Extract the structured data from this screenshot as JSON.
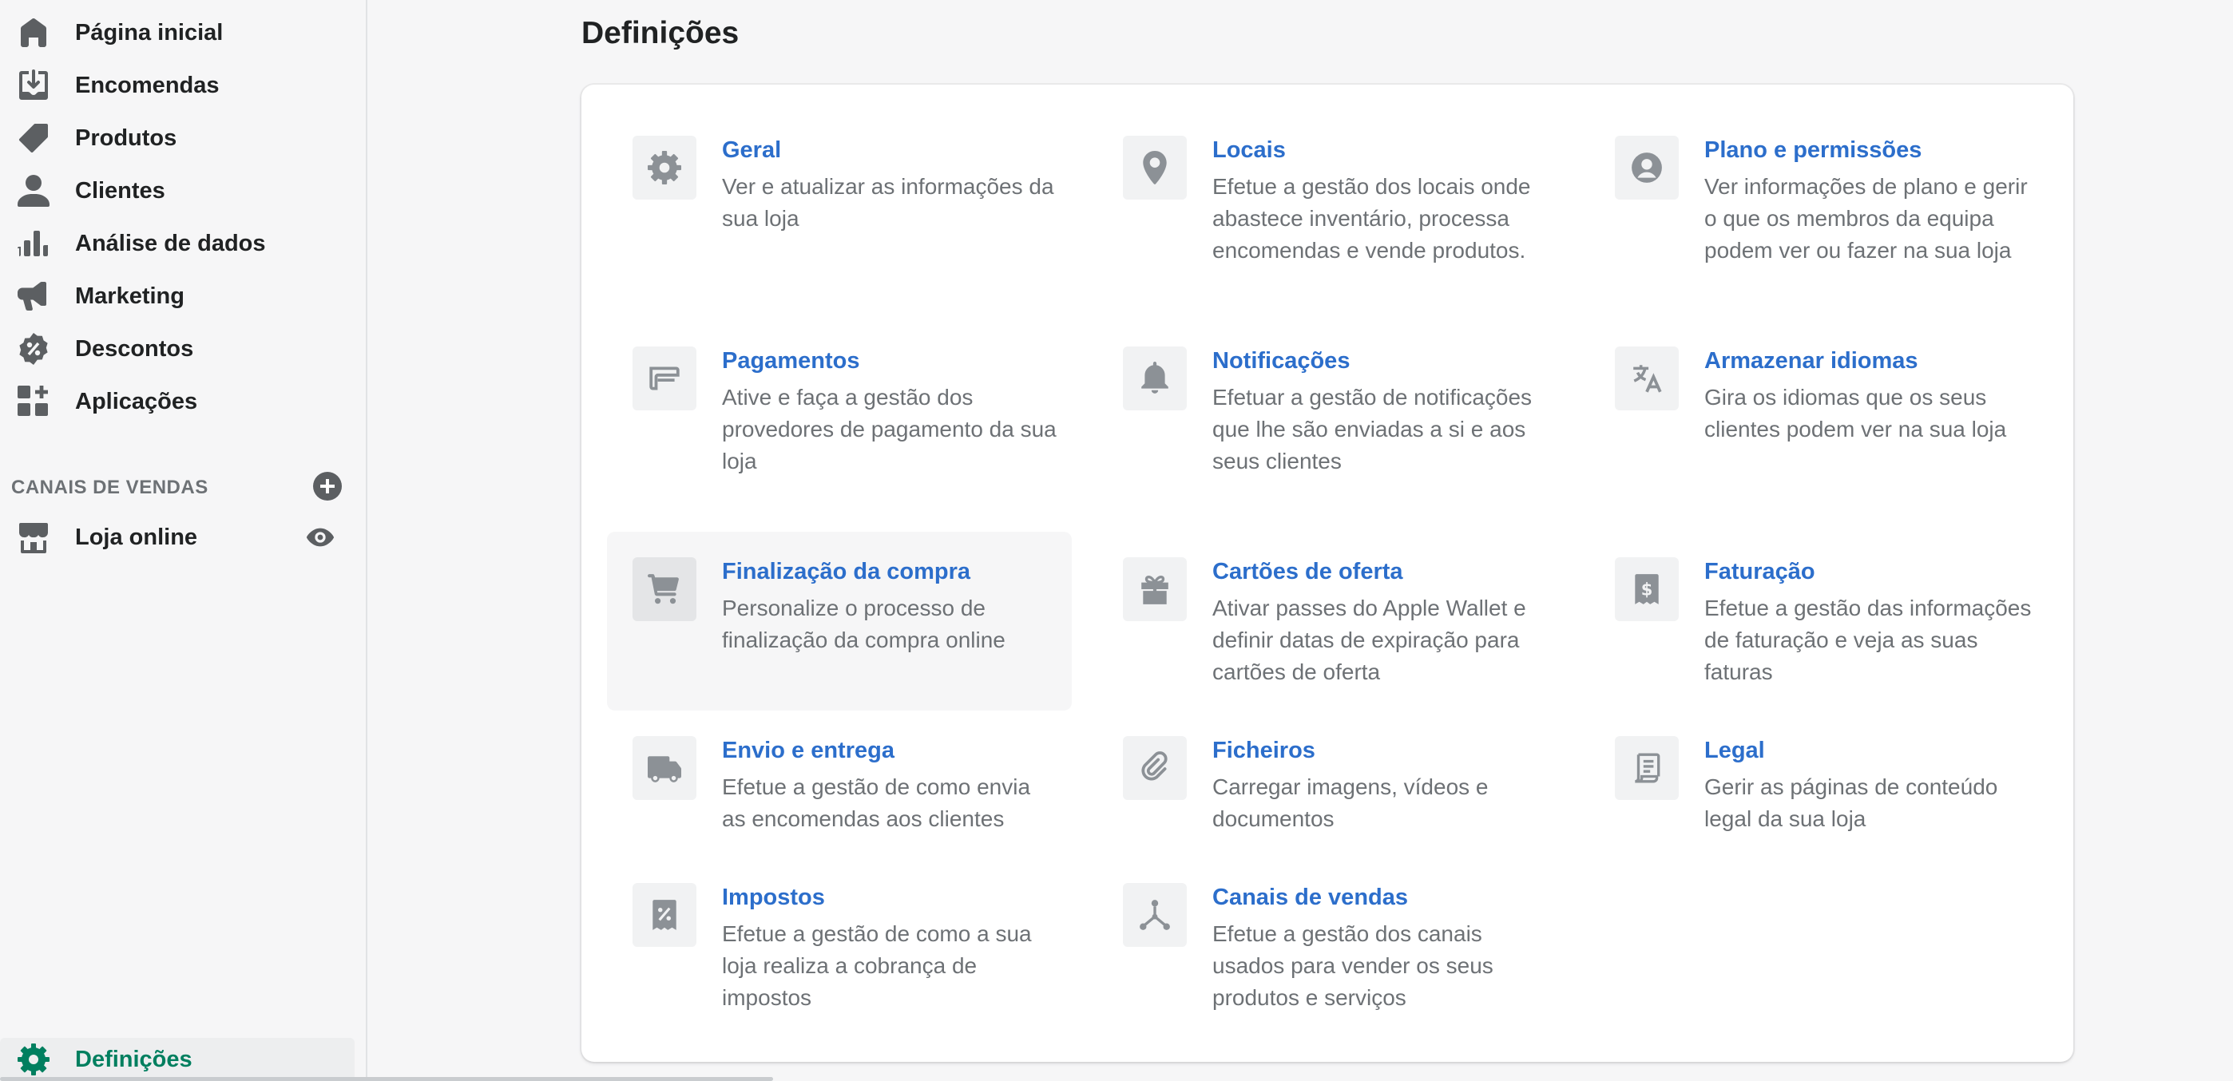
{
  "sidebar": {
    "items": [
      {
        "label": "Página inicial",
        "icon": "home-icon"
      },
      {
        "label": "Encomendas",
        "icon": "orders-icon"
      },
      {
        "label": "Produtos",
        "icon": "tag-icon"
      },
      {
        "label": "Clientes",
        "icon": "person-icon"
      },
      {
        "label": "Análise de dados",
        "icon": "bar-chart-icon"
      },
      {
        "label": "Marketing",
        "icon": "megaphone-icon"
      },
      {
        "label": "Descontos",
        "icon": "discount-icon"
      },
      {
        "label": "Aplicações",
        "icon": "apps-icon"
      }
    ],
    "sales_channels_header": "CANAIS DE VENDAS",
    "online_store": {
      "label": "Loja online",
      "icon": "store-icon"
    },
    "settings": {
      "label": "Definições",
      "icon": "gear-icon"
    }
  },
  "main": {
    "title": "Definições",
    "settings": [
      {
        "title": "Geral",
        "desc": "Ver e atualizar as informações da sua loja",
        "icon": "gear-icon"
      },
      {
        "title": "Locais",
        "desc": "Efetue a gestão dos locais onde abastece inventário, processa encomendas e vende produtos.",
        "icon": "location-pin-icon"
      },
      {
        "title": "Plano e permissões",
        "desc": "Ver informações de plano e gerir o que os membros da equipa podem ver ou fazer na sua loja",
        "icon": "user-circle-icon"
      },
      {
        "title": "Pagamentos",
        "desc": "Ative e faça a gestão dos provedores de pagamento da sua loja",
        "icon": "payments-icon"
      },
      {
        "title": "Notificações",
        "desc": "Efetuar a gestão de notificações que lhe são enviadas a si e aos seus clientes",
        "icon": "bell-icon"
      },
      {
        "title": "Armazenar idiomas",
        "desc": "Gira os idiomas que os seus clientes podem ver na sua loja",
        "icon": "translate-icon"
      },
      {
        "title": "Finalização da compra",
        "desc": "Personalize o processo de finalização da compra online",
        "icon": "cart-icon"
      },
      {
        "title": "Cartões de oferta",
        "desc": "Ativar passes do Apple Wallet e definir datas de expiração para cartões de oferta",
        "icon": "gift-icon"
      },
      {
        "title": "Faturação",
        "desc": "Efetue a gestão das informações de faturação e veja as suas faturas",
        "icon": "billing-icon"
      },
      {
        "title": "Envio e entrega",
        "desc": "Efetue a gestão de como envia as encomendas aos clientes",
        "icon": "truck-icon"
      },
      {
        "title": "Ficheiros",
        "desc": "Carregar imagens, vídeos e documentos",
        "icon": "paperclip-icon"
      },
      {
        "title": "Legal",
        "desc": "Gerir as páginas de conteúdo legal da sua loja",
        "icon": "document-icon"
      },
      {
        "title": "Impostos",
        "desc": "Efetue a gestão de como a sua loja realiza a cobrança de impostos",
        "icon": "tax-icon"
      },
      {
        "title": "Canais de vendas",
        "desc": "Efetue a gestão dos canais usados para vender os seus produtos e serviços",
        "icon": "channels-icon"
      }
    ]
  },
  "colors": {
    "link": "#2c6ecb",
    "active_green": "#007f5f",
    "icon_gray": "#8c9196",
    "nav_icon": "#5c5f62"
  }
}
